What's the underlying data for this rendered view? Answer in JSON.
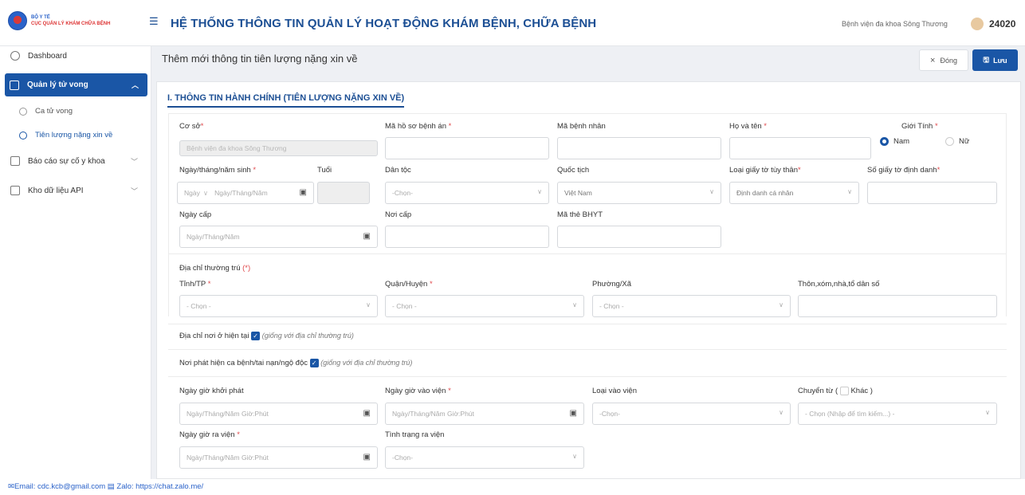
{
  "header": {
    "logo_line1": "BỘ Y TẾ",
    "logo_line2": "CỤC QUẢN LÝ KHÁM CHỮA BỆNH",
    "title": "HỆ THỐNG THÔNG TIN QUẢN LÝ HOẠT ĐỘNG KHÁM BỆNH, CHỮA BỆNH",
    "hospital": "Bệnh viện đa khoa Sông Thương",
    "user_id": "24020"
  },
  "sidebar": {
    "dashboard": "Dashboard",
    "death_mgmt": "Quản lý tử vong",
    "death_case": "Ca tử vong",
    "prognosis": "Tiên lượng nặng xin về",
    "incident_report": "Báo cáo sự cố y khoa",
    "api_store": "Kho dữ liệu API"
  },
  "page": {
    "title": "Thêm mới thông tin tiên lượng nặng xin về",
    "close_label": "Đóng",
    "save_label": "Lưu"
  },
  "form": {
    "section_title": "I. THÔNG TIN HÀNH CHÍNH (TIÊN LƯỢNG NẶNG XIN VỀ)",
    "facility_label": "Cơ sở",
    "facility_value": "Bệnh viện đa khoa Sông Thương",
    "record_label": "Mã hồ sơ bệnh án",
    "patient_code_label": "Mã bệnh nhân",
    "fullname_label": "Họ và tên",
    "gender_label": "Giới Tính",
    "gender_male": "Nam",
    "gender_female": "Nữ",
    "dob_label": "Ngày/tháng/năm sinh",
    "age_label": "Tuổi",
    "dob_type": "Ngày",
    "dob_placeholder": "Ngày/Tháng/Năm",
    "ethnic_label": "Dân tộc",
    "ethnic_value": "-Chọn-",
    "nationality_label": "Quốc tịch",
    "nationality_value": "Việt Nam",
    "id_type_label": "Loại giấy tờ tùy thân",
    "id_type_value": "Định danh cá nhân",
    "id_number_label": "Số giấy tờ định danh",
    "issue_date_label": "Ngày cấp",
    "issue_date_placeholder": "Ngày/Tháng/Năm",
    "issue_place_label": "Nơi cấp",
    "insurance_label": "Mã thẻ BHYT",
    "perm_address_label": "Địa chỉ thường trú",
    "perm_address_req": "(*)",
    "province_label": "Tỉnh/TP",
    "district_label": "Quận/Huyện",
    "ward_label": "Phường/Xã",
    "village_label": "Thôn,xóm,nhà,tổ dân số",
    "select_placeholder": "- Chọn -",
    "current_address_label": "Địa chỉ nơi ở hiện tại",
    "current_address_note": "(giống với địa chỉ thường trú)",
    "incident_place_label": "Nơi phát hiện ca bệnh/tai nạn/ngộ độc",
    "incident_place_note": "(giống với địa chỉ thường trú)",
    "onset_label": "Ngày giờ khởi phát",
    "datetime_placeholder": "Ngày/Tháng/Năm Giờ:Phút",
    "admission_label": "Ngày giờ vào viện",
    "admission_type_label": "Loại vào viện",
    "admission_type_value": "-Chọn-",
    "transfer_label": "Chuyển từ (",
    "transfer_other": "Khác",
    ")": ")",
    "transfer_value": "- Chọn (Nhập để tìm kiếm...) -",
    "discharge_label": "Ngày giờ ra viện",
    "discharge_status_label": "Tình trạng ra viện",
    "discharge_status_value": "-Chọn-"
  },
  "footer": {
    "email": "Email: cdc.kcb@gmail.com",
    "zalo": "Zalo: https://chat.zalo.me/"
  }
}
